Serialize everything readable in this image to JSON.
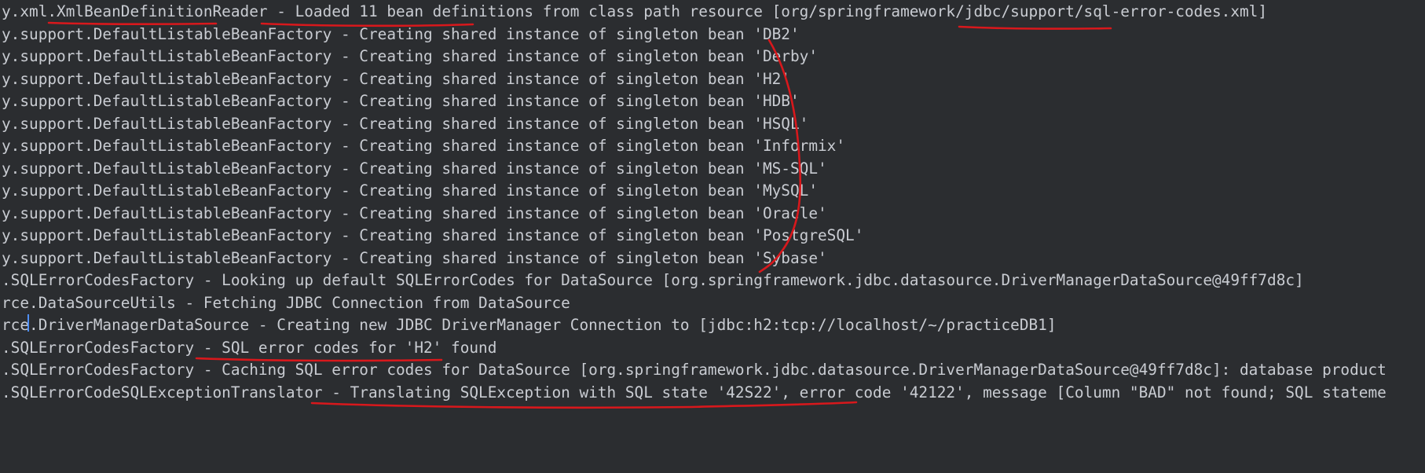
{
  "console": {
    "lines": [
      "y.xml.XmlBeanDefinitionReader - Loaded 11 bean definitions from class path resource [org/springframework/jdbc/support/sql-error-codes.xml]",
      "y.support.DefaultListableBeanFactory - Creating shared instance of singleton bean 'DB2'",
      "y.support.DefaultListableBeanFactory - Creating shared instance of singleton bean 'Derby'",
      "y.support.DefaultListableBeanFactory - Creating shared instance of singleton bean 'H2'",
      "y.support.DefaultListableBeanFactory - Creating shared instance of singleton bean 'HDB'",
      "y.support.DefaultListableBeanFactory - Creating shared instance of singleton bean 'HSQL'",
      "y.support.DefaultListableBeanFactory - Creating shared instance of singleton bean 'Informix'",
      "y.support.DefaultListableBeanFactory - Creating shared instance of singleton bean 'MS-SQL'",
      "y.support.DefaultListableBeanFactory - Creating shared instance of singleton bean 'MySQL'",
      "y.support.DefaultListableBeanFactory - Creating shared instance of singleton bean 'Oracle'",
      "y.support.DefaultListableBeanFactory - Creating shared instance of singleton bean 'PostgreSQL'",
      "y.support.DefaultListableBeanFactory - Creating shared instance of singleton bean 'Sybase'",
      ".SQLErrorCodesFactory - Looking up default SQLErrorCodes for DataSource [org.springframework.jdbc.datasource.DriverManagerDataSource@49ff7d8c]",
      "rce.DataSourceUtils - Fetching JDBC Connection from DataSource",
      "rce.DriverManagerDataSource - Creating new JDBC DriverManager Connection to [jdbc:h2:tcp://localhost/~/practiceDB1]",
      ".SQLErrorCodesFactory - SQL error codes for 'H2' found",
      ".SQLErrorCodesFactory - Caching SQL error codes for DataSource [org.springframework.jdbc.datasource.DriverManagerDataSource@49ff7d8c]: database product",
      ".SQLErrorCodeSQLExceptionTranslator - Translating SQLException with SQL state '42S22', error code '42122', message [Column \"BAD\" not found; SQL stateme"
    ]
  },
  "colors": {
    "background": "#2b2d30",
    "text": "#c9ccd2",
    "annotation": "#d8181c",
    "caret": "#4f8ff7"
  }
}
